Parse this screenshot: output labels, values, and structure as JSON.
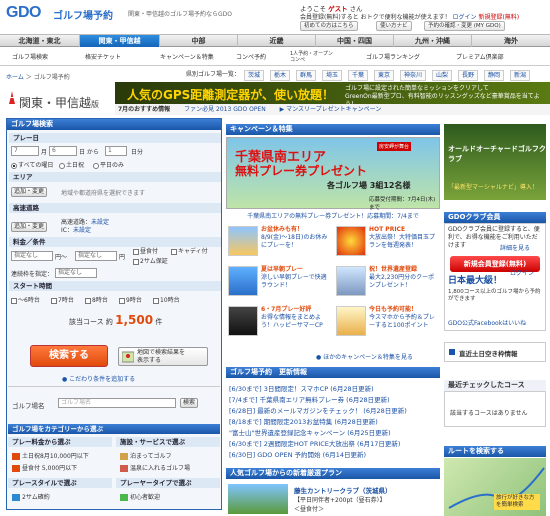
{
  "header": {
    "logo": "GDO",
    "logo_sub": "ゴルフ場予約",
    "tagline": "関東・甲信越のゴルフ場予約ならGDO",
    "welcome_prefix": "ようこそ",
    "welcome_user": "ゲスト",
    "welcome_suffix": "さん",
    "links_line": "会員登録(無料)すると おトクで便利な機能が使えます！",
    "login": "ログイン",
    "register": "新規登録(無料)",
    "btn_first_time": "初めての方はこちら",
    "btn_lucky": "使い方ナビ",
    "btn_reserve_check": "予約の確認・変更 (MY GDO)"
  },
  "regions": [
    "北海道・東北",
    "関東・甲信越",
    "中部",
    "近畿",
    "中国・四国",
    "九州・沖縄",
    "海外"
  ],
  "category_nav": [
    "ゴルフ場検索",
    "格安チケット",
    "キャンペーン＆特集",
    "コンペ予約",
    "1人予約・オープンコンペ",
    "ゴルフ場ランキング",
    "プレミアム倶楽部"
  ],
  "breadcrumb": {
    "home": "ホーム",
    "sep": "＞",
    "current": "ゴルフ場予約"
  },
  "pref_bar": {
    "label": "県別ゴルフ場一覧：",
    "prefs": [
      "茨城",
      "栃木",
      "群馬",
      "埼玉",
      "千葉",
      "東京",
      "神奈川",
      "山梨",
      "長野",
      "静岡",
      "新潟"
    ]
  },
  "area_title": "関東・甲信越",
  "area_suffix": "版",
  "gps_banner": {
    "title": "人気のGPS距離測定器が、使い放題！",
    "sub1": "ゴルフ場に設定された簡単なミッションをクリアして",
    "sub2": "GreenOn最新型プロ、有料智能のリッスングッズなど豪華賞品を当てよう！"
  },
  "rec_bar": {
    "label": "7月のおすすめ情報",
    "items": [
      "ファン必見 2013 GDO OPEN",
      "▶ マンスリープレゼントキャンペーン"
    ]
  },
  "search": {
    "title": "ゴルフ場検索",
    "play_day": "プレー日",
    "month": "7",
    "month_unit": "月",
    "day": "6",
    "day_unit": "日 から",
    "range": "1",
    "range_unit": "日分",
    "day_opts": [
      "すべての曜日",
      "土日祝",
      "平日のみ"
    ],
    "area": "エリア",
    "add_btn": "追加・変更",
    "area_hint": "地域や都道府県を選択できます",
    "highway": "高速道路",
    "highway_label": "高速道路：",
    "highway_val": "未設定",
    "ic_label": "IC：",
    "ic_val": "未設定",
    "price": "料金／条件",
    "price_min": "指定なし",
    "price_mid": "円～",
    "price_max": "指定なし",
    "price_unit": "円",
    "cond1": "昼食付",
    "cond2": "キャディ付",
    "cond3": "2サム保証",
    "consec": "連続枠を指定：",
    "consec_val": "指定なし",
    "start": "スタート時間",
    "start_opts": [
      "～6時台",
      "7時台",
      "8時台",
      "9時台",
      "10時台"
    ],
    "count_label": "該当コース 約",
    "count": "1,500",
    "count_unit": "件",
    "search_btn": "検索する",
    "map_btn1": "地図で検索結果を",
    "map_btn2": "表示する",
    "more_cond": "こだわり条件を追加する",
    "course_name_label": "ゴルフ場名",
    "course_name_placeholder": "ゴルフ場名",
    "course_search_btn": "検索"
  },
  "category_search": {
    "title": "ゴルフ場をカテゴリーから選ぶ",
    "price_head": "プレー料金から選ぶ",
    "price_items": [
      "土日祝8月10,000円以下",
      "昼食付   5,000円以下"
    ],
    "facility_head": "施設・サービスで選ぶ",
    "facility_items": [
      "泊まってゴルフ",
      "温泉に入れるゴルフ場"
    ],
    "style_head": "プレースタイルで選ぶ",
    "style_items": [
      "2サム確約"
    ],
    "type_head": "プレーヤータイプで選ぶ",
    "type_items": [
      "初心者歓迎"
    ]
  },
  "campaign": {
    "title": "キャンペーン＆特集",
    "chiba_tag": "房安岬が舞台",
    "chiba_line1": "千葉県南エリア",
    "chiba_line2": "無料プレー券プレゼント",
    "chiba_line3": "各ゴルフ場 3組12名様",
    "chiba_line4": "応募受付期間：7月4日(木)まで",
    "chiba_caption": "千葉県南エリアの無料プレー券プレゼント！応募期間：7/4まで",
    "cards": [
      {
        "title": "お盆休みも有！",
        "text": "8/9(金)～18日)のお休みにプレーを！"
      },
      {
        "title": "HOT PRICE",
        "text": "大放出祭！大特価目玉プランを毎週発表！"
      },
      {
        "title": "夏は早朝プレー",
        "text": "涼しい早朝プレーで快適ラウンド！"
      },
      {
        "title": "祝！世界遺産登録",
        "text": "最大2,230円分のクーポンプレゼント！"
      },
      {
        "title": "6・7月プレー好評",
        "text": "お得な情報をまとめよう！ハッピーサマーCP"
      },
      {
        "title": "今日も予約可能！",
        "text": "今スマホから予約＆プレーすると100ポイント"
      }
    ],
    "more_link": "ほかのキャンペーン＆特集を見る"
  },
  "updates": {
    "title": "ゴルフ場予約　更新情報",
    "items": [
      "[6/30まで] 3日間限定！スマホCP (6月28日更新)",
      "[7/4まで] 千葉県南エリア無料プレー券 (6月28日更新)",
      "[6/28日] 最新のメールマガジンをチェック！ (6月28日更新)",
      "[8/18まで] 期間限定2013お盆特集 (6月28日更新)",
      "\"富士山\"世界遺産登録記念キャンペーン (6月25日更新)",
      "[6/30まで] 2週間限定HOT PRICE大放出祭 (6月17日更新)",
      "[6/30日] GDO OPEN 予約開始 (6月14日更新)"
    ]
  },
  "popular": {
    "title": "人気ゴルフ場からの新着厳選プラン",
    "item_title": "藤生カントリークラブ（茨城県）",
    "item_text": "【平日同伴者+200pt（昼石券）】",
    "item_sub": "＜昼食付＞"
  },
  "right": {
    "orchard_title": "オールドオーチャードゴルフクラブ",
    "orchard_sub": "「最新型マーシャルナビ」導入！",
    "member_head": "GDOクラブ会員",
    "member_text": "GDOクラブ会員に登録すると、便利で、お得な機能をご利用いただけます",
    "member_link": "詳細を見る",
    "register_btn": "新規会員登録(無料)",
    "login_link": "ログイン",
    "largest_title": "日本最大級！",
    "largest_text": "1,800コース以上のゴルフ場から予約ができます",
    "fb_link": "GDO公式Facebookはいいね",
    "promo_text": "直近土日空き枠情報",
    "recent_head": "最近チェックしたコース",
    "recent_text": "該当するコースはありません",
    "route_head": "ルートを検索する",
    "route_map_text": "旅行が好きな方を簡単検索"
  },
  "colors": {
    "brand": "#1a56a8",
    "accent": "#e04a0c",
    "alert": "#cc0000"
  }
}
